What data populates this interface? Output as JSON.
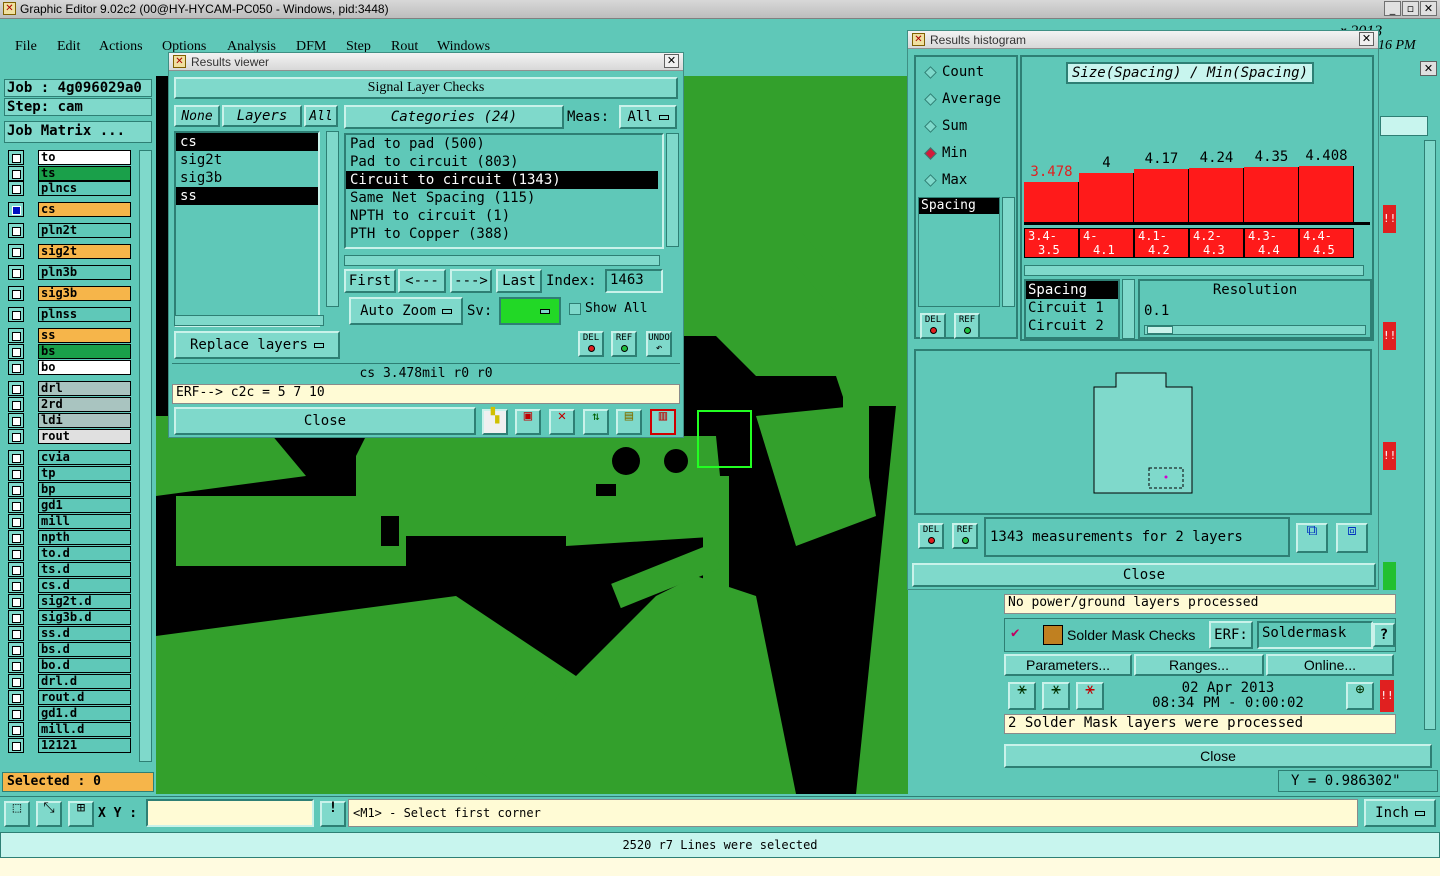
{
  "app": {
    "title": "Graphic Editor 9.02c2 (00@HY-HYCAM-PC050 - Windows, pid:3448)",
    "menu": [
      "File",
      "Edit",
      "Actions",
      "Options",
      "Analysis",
      "DFM",
      "Step",
      "Rout",
      "Windows"
    ],
    "top_right_clip_date": "r 2013",
    "top_right_clip_time": "16 PM"
  },
  "left_panel": {
    "job": "Job : 4g096029a0",
    "step": "Step: cam",
    "job_matrix": "Job Matrix ...",
    "layers": [
      {
        "name": "to",
        "color": "white"
      },
      {
        "name": "ts",
        "color": "green"
      },
      {
        "name": "plncs",
        "color": "lc"
      },
      {
        "name": "cs",
        "color": "orange"
      },
      {
        "name": "pln2t",
        "color": "lc"
      },
      {
        "name": "sig2t",
        "color": "orange"
      },
      {
        "name": "pln3b",
        "color": "lc"
      },
      {
        "name": "sig3b",
        "color": "orange"
      },
      {
        "name": "plnss",
        "color": "lc"
      },
      {
        "name": "ss",
        "color": "orange"
      },
      {
        "name": "bs",
        "color": "green"
      },
      {
        "name": "bo",
        "color": "white"
      },
      {
        "name": "drl",
        "color": "gray"
      },
      {
        "name": "2rd",
        "color": "gray"
      },
      {
        "name": "ldi",
        "color": "gray"
      },
      {
        "name": "rout",
        "color": "light"
      },
      {
        "name": "cvia",
        "color": "lc"
      },
      {
        "name": "tp",
        "color": "lc"
      },
      {
        "name": "bp",
        "color": "lc"
      },
      {
        "name": "gd1",
        "color": "lc"
      },
      {
        "name": "mill",
        "color": "lc"
      },
      {
        "name": "npth",
        "color": "lc"
      },
      {
        "name": "to.d",
        "color": "lc"
      },
      {
        "name": "ts.d",
        "color": "lc"
      },
      {
        "name": "cs.d",
        "color": "lc"
      },
      {
        "name": "sig2t.d",
        "color": "lc"
      },
      {
        "name": "sig3b.d",
        "color": "lc"
      },
      {
        "name": "ss.d",
        "color": "lc"
      },
      {
        "name": "bs.d",
        "color": "lc"
      },
      {
        "name": "bo.d",
        "color": "lc"
      },
      {
        "name": "drl.d",
        "color": "lc"
      },
      {
        "name": "rout.d",
        "color": "lc"
      },
      {
        "name": "gd1.d",
        "color": "lc"
      },
      {
        "name": "mill.d",
        "color": "lc"
      },
      {
        "name": "12121",
        "color": "lc"
      }
    ],
    "selected": "Selected : 0"
  },
  "results_viewer": {
    "title": "Results viewer",
    "header": "Signal Layer Checks",
    "none_btn": "None",
    "layers_btn": "Layers",
    "all_btn": "All",
    "layers": [
      "cs",
      "sig2t",
      "sig3b",
      "ss"
    ],
    "categories_label": "Categories (24)",
    "meas_label": "Meas:",
    "meas_value": "All",
    "categories": [
      "Pad to pad (500)",
      "Pad to circuit (803)",
      "Circuit to circuit (1343)",
      "Same Net Spacing (115)",
      "NPTH to circuit (1)",
      "PTH to Copper (388)"
    ],
    "first": "First",
    "prev": "<---",
    "next": "--->",
    "last": "Last",
    "index_label": "Index:",
    "index_value": "1463",
    "auto_zoom": "Auto Zoom",
    "sv_label": "Sv:",
    "show_all": "Show All",
    "replace_layers": "Replace layers",
    "del": "DEL",
    "ref": "REF",
    "undo": "UNDO",
    "measurement": "cs 3.478mil  r0  r0",
    "erf_line": "ERF--> c2c = 5 7 10",
    "close": "Close"
  },
  "histogram": {
    "title": "Results histogram",
    "stats": [
      "Count",
      "Average",
      "Sum",
      "Min",
      "Max"
    ],
    "stat_selected": "Min",
    "heading": "Size(Spacing) / Min(Spacing)",
    "attribute": "Spacing",
    "attrs": [
      "Spacing",
      "Circuit 1",
      "Circuit 2"
    ],
    "resolution_label": "Resolution",
    "resolution_value": "0.1",
    "summary": "1343 measurements for 2 layers",
    "close": "Close",
    "del": "DEL",
    "ref": "REF",
    "bins": [
      {
        "value": "3.478",
        "range_a": "3.4-",
        "range_b": "3.5",
        "frac": 0.72
      },
      {
        "value": "4",
        "range_a": "4-",
        "range_b": "4.1",
        "frac": 0.88
      },
      {
        "value": "4.17",
        "range_a": "4.1-",
        "range_b": "4.2",
        "frac": 0.94
      },
      {
        "value": "4.24",
        "range_a": "4.2-",
        "range_b": "4.3",
        "frac": 0.96
      },
      {
        "value": "4.35",
        "range_a": "4.3-",
        "range_b": "4.4",
        "frac": 0.99
      },
      {
        "value": "4.408",
        "range_a": "4.4-",
        "range_b": "4.5",
        "frac": 1.0
      }
    ]
  },
  "drc": {
    "no_power": "No power/ground layers processed",
    "solder_mask": "Solder Mask Checks",
    "erf_label": "ERF:",
    "erf_value": "Soldermask",
    "parameters": "Parameters...",
    "ranges": "Ranges...",
    "online": "Online...",
    "date": "02 Apr 2013",
    "time": "08:34 PM - 0:00:02",
    "processed": "2 Solder Mask layers were processed",
    "close": "Close",
    "y_coord": "Y = 0.986302\""
  },
  "bottom": {
    "xy_label": "X Y :",
    "hint": "<M1> - Select first corner",
    "units": "Inch",
    "status": "2520 r7 Lines were selected"
  }
}
